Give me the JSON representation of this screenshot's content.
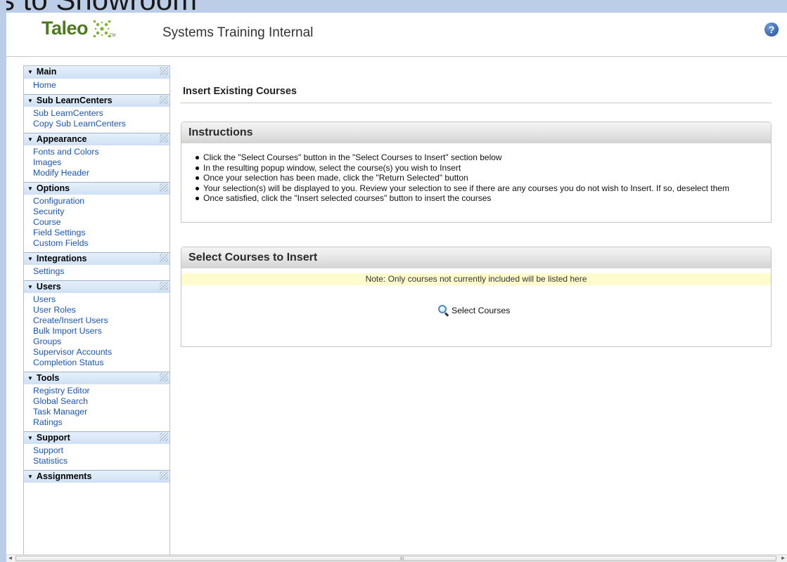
{
  "background": {
    "slide_title_fragment": "s to Showroom"
  },
  "header": {
    "logo_text": "Taleo",
    "logo_tm": "TM",
    "app_title": "Systems Training Internal",
    "help_glyph": "?",
    "help_icon": "help-circle-icon"
  },
  "sidebar": {
    "sections": [
      {
        "title": "Main",
        "items": [
          "Home"
        ]
      },
      {
        "title": "Sub LearnCenters",
        "items": [
          "Sub LearnCenters",
          "Copy Sub LearnCenters"
        ]
      },
      {
        "title": "Appearance",
        "items": [
          "Fonts and Colors",
          "Images",
          "Modify Header"
        ]
      },
      {
        "title": "Options",
        "items": [
          "Configuration",
          "Security",
          "Course",
          "Field Settings",
          "Custom Fields"
        ]
      },
      {
        "title": "Integrations",
        "items": [
          "Settings"
        ]
      },
      {
        "title": "Users",
        "items": [
          "Users",
          "User Roles",
          "Create/Insert Users",
          "Bulk Import Users",
          "Groups",
          "Supervisor Accounts",
          "Completion Status"
        ]
      },
      {
        "title": "Tools",
        "items": [
          "Registry Editor",
          "Global Search",
          "Task Manager",
          "Ratings"
        ]
      },
      {
        "title": "Support",
        "items": [
          "Support",
          "Statistics"
        ]
      },
      {
        "title": "Assignments",
        "items": []
      }
    ]
  },
  "main": {
    "page_title": "Insert Existing Courses",
    "instructions": {
      "title": "Instructions",
      "items": [
        "Click the \"Select Courses\" button in the \"Select Courses to Insert\" section below",
        "In the resulting popup window, select the course(s) you wish to Insert",
        "Once your selection has been made, click the \"Return Selected\" button",
        "Your selection(s) will be displayed to you. Review your selection to see if there are any courses you do not wish to Insert. If so, deselect them",
        "Once satisfied, click the \"Insert selected courses\" button to insert the courses"
      ]
    },
    "select_panel": {
      "title": "Select Courses to Insert",
      "note": "Note: Only courses not currently included will be listed here",
      "button_label": "Select Courses",
      "button_icon": "magnifier-icon"
    }
  },
  "scrollbar": {
    "left_arrow": "◀",
    "right_arrow": "▶",
    "grip": "III"
  }
}
